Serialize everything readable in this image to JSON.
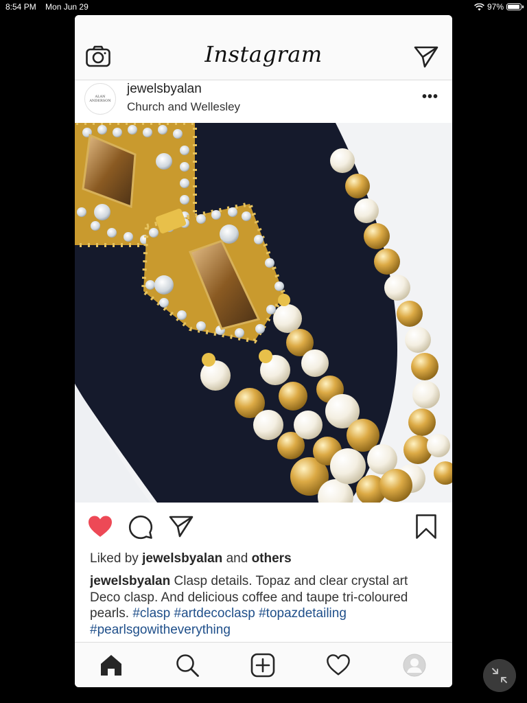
{
  "status_bar": {
    "time": "8:54 PM",
    "date": "Mon Jun 29",
    "battery": "97%",
    "battery_level": 0.97
  },
  "header": {
    "app_title": "Instagram",
    "icons": [
      "camera-icon",
      "direct-send-icon"
    ]
  },
  "post": {
    "username": "jewelsbyalan",
    "location": "Church and Wellesley",
    "avatar_text": "ALAN ANDERSON",
    "liked": true,
    "likes": {
      "prefix": "Liked by",
      "user": "jewelsbyalan",
      "connector": "and",
      "others": "others"
    },
    "caption": {
      "username": "jewelsbyalan",
      "text": "Clasp details. Topaz and clear crystal art Deco clasp. And delicious coffee and taupe tri-coloured pearls.",
      "hashtags": [
        "#clasp",
        "#artdecoclasp",
        "#topazdetailing",
        "#pearlsgowitheverything"
      ]
    },
    "colors": {
      "heart": "#ed4956",
      "hashtag": "#1f4f8a",
      "velvet": "#151a2c",
      "gold": "#d4a838"
    }
  },
  "tab_bar": {
    "icons": [
      "home-icon",
      "search-icon",
      "new-post-icon",
      "activity-heart-icon",
      "profile-icon"
    ]
  }
}
